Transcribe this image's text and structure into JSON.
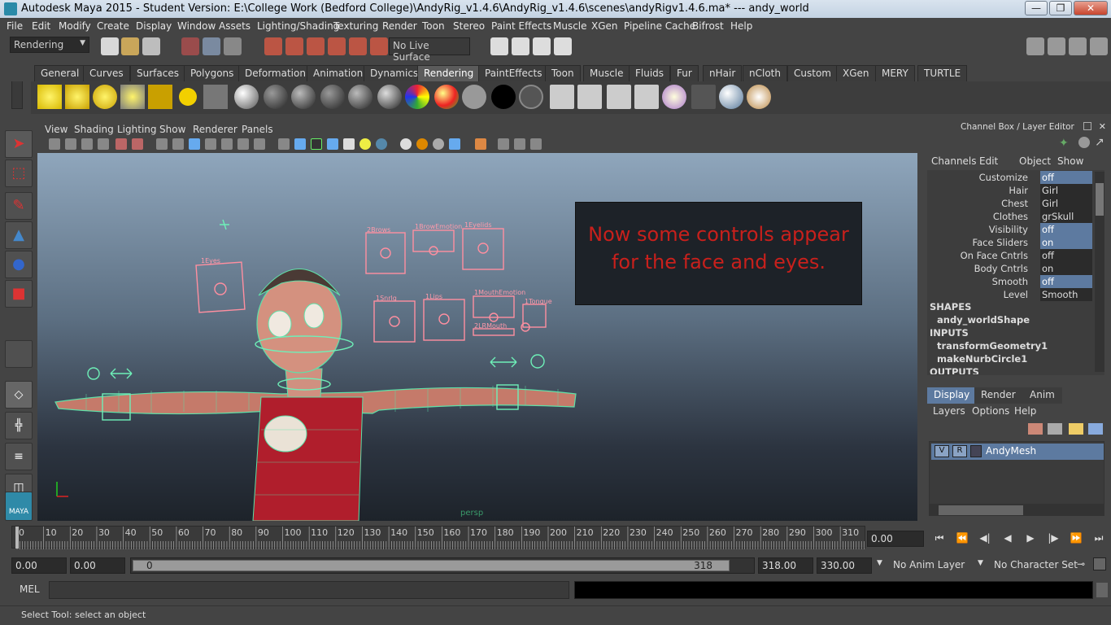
{
  "window": {
    "title": "Autodesk Maya 2015 - Student Version: E:\\College Work (Bedford College)\\AndyRig_v1.4.6\\AndyRig_v1.4.6\\scenes\\andyRigv1.4.6.ma*   ---   andy_world",
    "minimize": "—",
    "maximize": "❐",
    "close": "✕"
  },
  "menu": [
    "File",
    "Edit",
    "Modify",
    "Create",
    "Display",
    "Window",
    "Assets",
    "Lighting/Shading",
    "Texturing",
    "Render",
    "Toon",
    "Stereo",
    "Paint Effects",
    "Muscle",
    "XGen",
    "Pipeline Cache",
    "Bifrost",
    "Help"
  ],
  "status": {
    "menuset": "Rendering",
    "live_surface": "No Live Surface"
  },
  "shelf_tabs": [
    "General",
    "Curves",
    "Surfaces",
    "Polygons",
    "Deformation",
    "Animation",
    "Dynamics",
    "Rendering",
    "PaintEffects",
    "Toon",
    "Muscle",
    "Fluids",
    "Fur",
    "nHair",
    "nCloth",
    "Custom",
    "XGen",
    "MERY",
    "TURTLE"
  ],
  "active_shelf_tab": "Rendering",
  "panel_menu": [
    "View",
    "Shading",
    "Lighting",
    "Show",
    "Renderer",
    "Panels"
  ],
  "viewport": {
    "camera": "persp",
    "overlay_text_1": "Now some controls appear",
    "overlay_text_2": "for the face and eyes.",
    "controls": [
      "1Eyes",
      "2Brows",
      "1BrowEmotion",
      "1Eyelids",
      "1Snrlg",
      "1Lips",
      "1MouthEmotion",
      "1Tongue",
      "2LRMouth"
    ]
  },
  "channel_box": {
    "title": "Channel Box / Layer Editor",
    "menu": [
      "Channels",
      "Edit",
      "Object",
      "Show"
    ],
    "attributes": [
      {
        "label": "Customize",
        "value": "off",
        "hi": true
      },
      {
        "label": "Hair",
        "value": "Girl",
        "hi": false
      },
      {
        "label": "Chest",
        "value": "Girl",
        "hi": false
      },
      {
        "label": "Clothes",
        "value": "grSkull",
        "hi": false
      },
      {
        "label": "Visibility",
        "value": "off",
        "hi": true
      },
      {
        "label": "Face Sliders",
        "value": "on",
        "hi": true
      },
      {
        "label": "On Face Cntrls",
        "value": "off",
        "hi": false
      },
      {
        "label": "Body Cntrls",
        "value": "on",
        "hi": false
      },
      {
        "label": "Smooth",
        "value": "off",
        "hi": true
      },
      {
        "label": "Level",
        "value": "Smooth",
        "hi": false
      }
    ],
    "shapes_header": "SHAPES",
    "shape": "andy_worldShape",
    "inputs_header": "INPUTS",
    "inputs": [
      "transformGeometry1",
      "makeNurbCircle1"
    ],
    "outputs_header": "OUTPUTS"
  },
  "layer_editor": {
    "tabs": [
      "Display",
      "Render",
      "Anim"
    ],
    "menu": [
      "Layers",
      "Options",
      "Help"
    ],
    "layer_v": "V",
    "layer_r": "R",
    "layer_name": "AndyMesh"
  },
  "timeline": {
    "ticks": [
      "0",
      "10",
      "20",
      "30",
      "40",
      "50",
      "60",
      "70",
      "80",
      "90",
      "100",
      "110",
      "120",
      "130",
      "140",
      "150",
      "160",
      "170",
      "180",
      "190",
      "200",
      "210",
      "220",
      "230",
      "240",
      "250",
      "260",
      "270",
      "280",
      "290",
      "300",
      "310"
    ],
    "current_frame": "0.00",
    "playback_icons": [
      "⏮",
      "⏪",
      "◀|",
      "◀",
      "▶",
      "|▶",
      "⏩",
      "⏭"
    ]
  },
  "range": {
    "start": "0.00",
    "playback_start": "0.00",
    "slider_start": "0",
    "slider_end": "318",
    "playback_end": "318.00",
    "end": "330.00",
    "anim_layer": "No Anim Layer",
    "character_set": "No Character Set"
  },
  "command": {
    "label": "MEL"
  },
  "help": {
    "text": "Select Tool: select an object"
  }
}
